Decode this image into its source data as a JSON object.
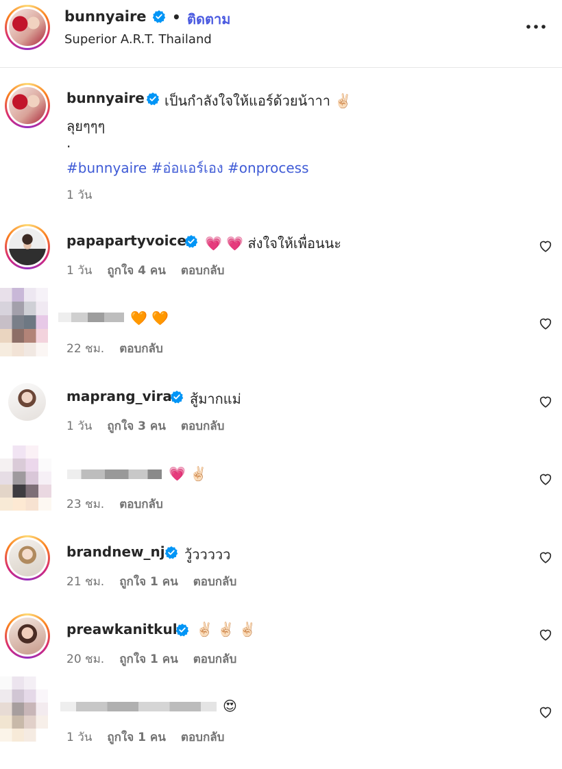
{
  "post_header": {
    "username": "bunnyaire",
    "separator": "•",
    "follow_label": "ติดตาม",
    "location": "Superior A.R.T. Thailand",
    "more_icon": "more-horizontal-icon"
  },
  "caption": {
    "username": "bunnyaire",
    "line1": "เป็นกำลังใจให้แอร์ด้วยน้าาา ✌🏻",
    "line2": "ลุยๆๆๆ",
    "line3": ".",
    "hashtags": "#bunnyaire #อ่อแอร์เอง #onprocess",
    "time": "1 วัน"
  },
  "comments": [
    {
      "username": "papapartyvoice",
      "verified": true,
      "text": "💗 💗 ส่งใจให้เพื่อนนะ",
      "time": "1 วัน",
      "likes": "ถูกใจ 4 คน",
      "reply": "ตอบกลับ"
    },
    {
      "username": "",
      "verified": false,
      "text": "🧡 🧡",
      "time": "22 ชม.",
      "likes": "",
      "reply": "ตอบกลับ"
    },
    {
      "username": "maprang_vira",
      "verified": true,
      "text": "สู้มากแม่",
      "time": "1 วัน",
      "likes": "ถูกใจ 3 คน",
      "reply": "ตอบกลับ"
    },
    {
      "username": "",
      "verified": false,
      "text": "💗 ✌🏻",
      "time": "23 ชม.",
      "likes": "",
      "reply": "ตอบกลับ"
    },
    {
      "username": "brandnew_nj",
      "verified": true,
      "text": "วู้ววววว",
      "time": "21 ชม.",
      "likes": "ถูกใจ 1 คน",
      "reply": "ตอบกลับ"
    },
    {
      "username": "preawkanitkul",
      "verified": true,
      "text": "✌🏻 ✌🏻 ✌🏻",
      "time": "20 ชม.",
      "likes": "ถูกใจ 1 คน",
      "reply": "ตอบกลับ"
    },
    {
      "username": "",
      "verified": false,
      "text": "😍",
      "time": "1 วัน",
      "likes": "ถูกใจ 1 คน",
      "reply": "ตอบกลับ"
    }
  ],
  "colors": {
    "link": "#3f5bd6",
    "verified": "#0095f6",
    "meta": "#737373"
  }
}
